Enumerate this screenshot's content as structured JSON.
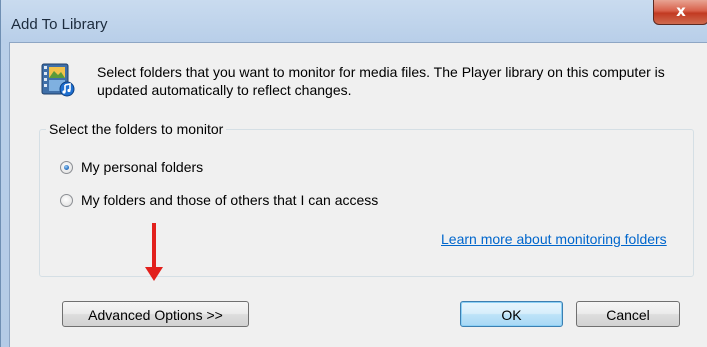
{
  "window": {
    "title": "Add To Library",
    "close_glyph": "x"
  },
  "header": {
    "icon": "media-library-icon",
    "description": "Select folders that you want to monitor for media files. The Player library on this computer is updated automatically to reflect changes."
  },
  "group": {
    "legend": "Select the folders to monitor",
    "options": [
      {
        "label": "My personal folders",
        "checked": true
      },
      {
        "label": "My folders and those of others that I can access",
        "checked": false
      }
    ],
    "learn_more_link": "Learn more about monitoring folders"
  },
  "annotation": {
    "arrow_color": "#e2201c"
  },
  "buttons": {
    "advanced": "Advanced Options >>",
    "ok": "OK",
    "cancel": "Cancel"
  }
}
